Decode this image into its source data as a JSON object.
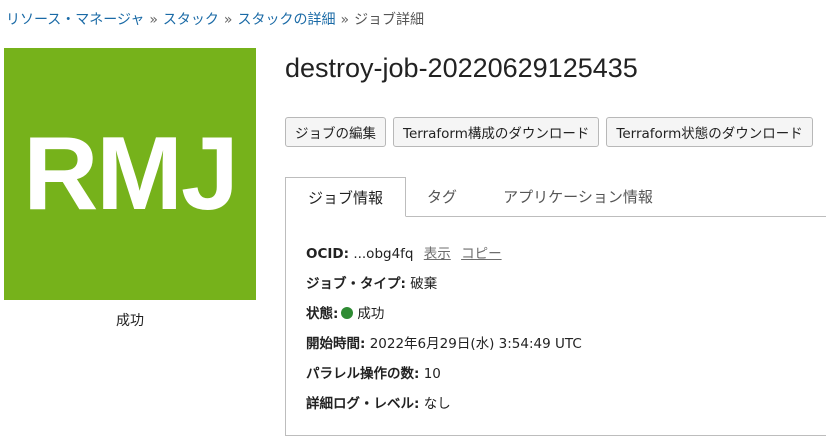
{
  "breadcrumb": {
    "items": [
      "リソース・マネージャ",
      "スタック",
      "スタックの詳細"
    ],
    "separator": "»",
    "current": "ジョブ詳細"
  },
  "logo": {
    "text": "RMJ",
    "background": "#76b21b"
  },
  "job_status_label": "成功",
  "title": "destroy-job-20220629125435",
  "actions": {
    "edit": "ジョブの編集",
    "download_config": "Terraform構成のダウンロード",
    "download_state": "Terraform状態のダウンロード"
  },
  "tabs": {
    "job_info": "ジョブ情報",
    "tags": "タグ",
    "app_info": "アプリケーション情報"
  },
  "details": {
    "ocid_label": "OCID:",
    "ocid_value": "...obg4fq",
    "show_link": "表示",
    "copy_link": "コピー",
    "job_type_label": "ジョブ・タイプ:",
    "job_type_value": "破棄",
    "state_label": "状態:",
    "state_value": "成功",
    "state_color": "#2e8b33",
    "started_label": "開始時間:",
    "started_value": "2022年6月29日(水) 3:54:49 UTC",
    "parallel_label": "パラレル操作の数:",
    "parallel_value": "10",
    "log_level_label": "詳細ログ・レベル:",
    "log_level_value": "なし"
  },
  "colors": {
    "link": "#1a6aa6",
    "accent_green": "#76b21b"
  }
}
